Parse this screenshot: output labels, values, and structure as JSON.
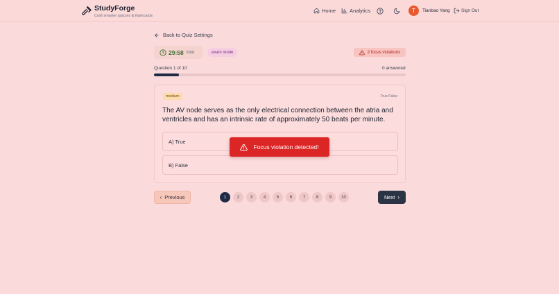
{
  "brand": {
    "name": "StudyForge",
    "tagline": "Craft smarter quizzes & flashcards",
    "icon": "hammer-icon"
  },
  "nav": {
    "home": "Home",
    "analytics": "Analytics",
    "help_icon": "help-circle-icon",
    "theme_icon": "moon-icon",
    "user": {
      "initial": "T",
      "name": "Tianbao Yang",
      "avatar_color": "#e8592d"
    },
    "signout": "Sign Out"
  },
  "quiz": {
    "back_label": "Back to Quiz Settings",
    "timer": {
      "value": "29:58",
      "label": "total"
    },
    "mode": "exam mode",
    "violations": "2 focus violations",
    "progress_label": "Question 1 of 10",
    "answered_label": "0 answered",
    "progress_fraction": 0.1
  },
  "question": {
    "difficulty": "medium",
    "type": "True False",
    "text": "The AV node serves as the only electrical connection between the atria and ventricles and has an intrinsic rate of approximately 50 beats per minute.",
    "options": [
      "A) True",
      "B) False"
    ]
  },
  "toast": {
    "message": "Focus violation detected!"
  },
  "pagination": {
    "previous": "Previous",
    "next": "Next",
    "pages": [
      "1",
      "2",
      "3",
      "4",
      "5",
      "6",
      "7",
      "8",
      "9",
      "10"
    ],
    "current": 1
  },
  "colors": {
    "background": "#fadadb",
    "primary_dark": "#1f2a44",
    "danger": "#dc2626",
    "timer": "#3d6b2e"
  }
}
